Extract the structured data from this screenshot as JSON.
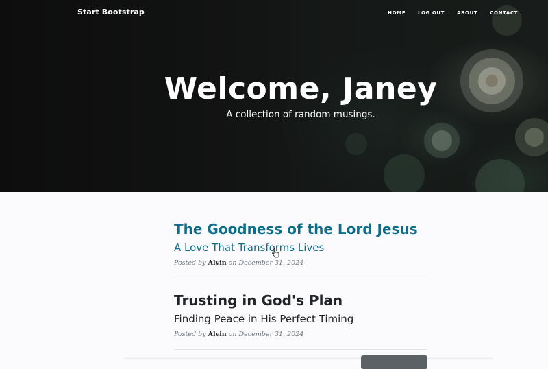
{
  "navbar": {
    "brand": "Start Bootstrap",
    "links": [
      "Home",
      "Log Out",
      "About",
      "Contact"
    ]
  },
  "hero": {
    "title": "Welcome, Janey",
    "subtitle": "A collection of random musings."
  },
  "posts": [
    {
      "title": "The Goodness of the Lord Jesus",
      "subtitle": "A Love That Transforms Lives",
      "posted_by_prefix": "Posted by",
      "author": "Alvin",
      "date_prefix": "on",
      "date": "December 31, 2024"
    },
    {
      "title": "Trusting in God's Plan",
      "subtitle": "Finding Peace in His Perfect Timing",
      "posted_by_prefix": "Posted by",
      "author": "Alvin",
      "date_prefix": "on",
      "date": "December 31, 2024"
    }
  ],
  "colors": {
    "link_hover": "#0d6e8a",
    "text": "#212529",
    "meta": "#6c757d",
    "button": "#5c6165"
  },
  "icons": {
    "cursor": "hand-pointer-icon"
  }
}
